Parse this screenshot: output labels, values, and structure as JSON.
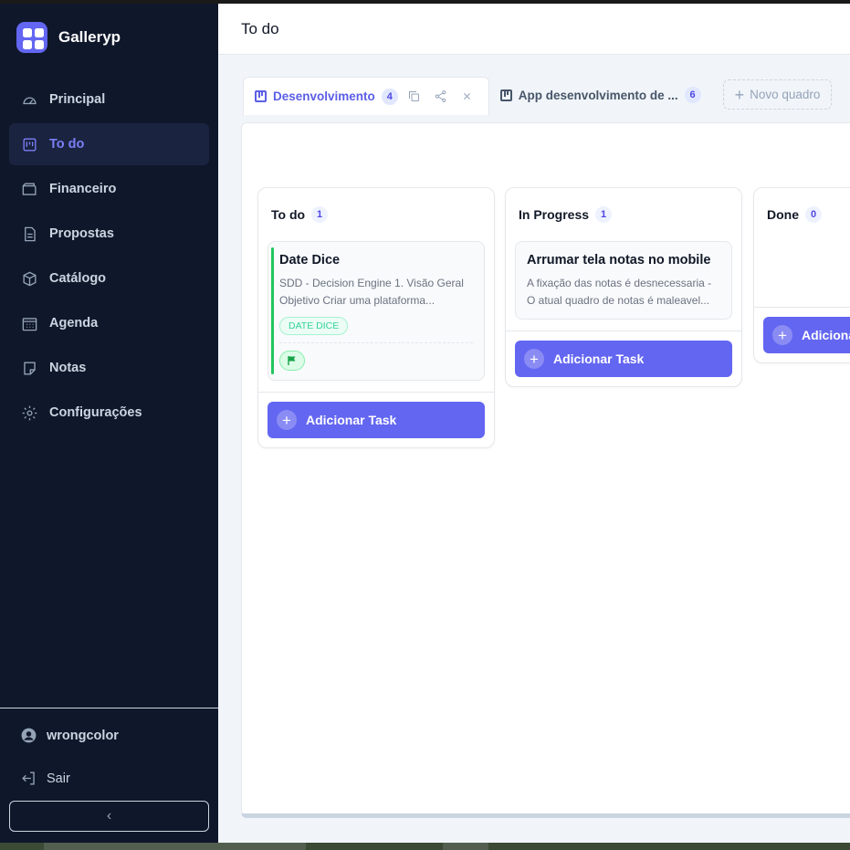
{
  "app": {
    "name": "Galleryp"
  },
  "sidebar": {
    "items": [
      {
        "label": "Principal",
        "icon": "gauge-icon",
        "active": false
      },
      {
        "label": "To do",
        "icon": "kanban-icon",
        "active": true
      },
      {
        "label": "Financeiro",
        "icon": "wallet-icon",
        "active": false
      },
      {
        "label": "Propostas",
        "icon": "document-icon",
        "active": false
      },
      {
        "label": "Catálogo",
        "icon": "box-icon",
        "active": false
      },
      {
        "label": "Agenda",
        "icon": "calendar-icon",
        "active": false
      },
      {
        "label": "Notas",
        "icon": "note-icon",
        "active": false
      },
      {
        "label": "Configurações",
        "icon": "gear-icon",
        "active": false
      }
    ],
    "user": {
      "name": "wrongcolor"
    },
    "logout_label": "Sair",
    "collapse_label": "‹"
  },
  "header": {
    "title": "To do"
  },
  "tabs": [
    {
      "label": "Desenvolvimento",
      "count": "4",
      "active": true
    },
    {
      "label": "App desenvolvimento de ...",
      "count": "6",
      "active": false
    }
  ],
  "new_board_label": "Novo quadro",
  "columns": [
    {
      "title": "To do",
      "count": "1",
      "cards": [
        {
          "title": "Date Dice",
          "description": "SDD - Decision Engine 1. Visão Geral Objetivo Criar uma plataforma...",
          "tag": "DATE DICE",
          "flag": "green"
        }
      ],
      "add_label": "Adicionar Task"
    },
    {
      "title": "In Progress",
      "count": "1",
      "cards": [
        {
          "title": "Arrumar tela notas no mobile",
          "description": "A fixação das notas é desnecessaria - O atual quadro de notas é maleavel..."
        }
      ],
      "add_label": "Adicionar Task"
    },
    {
      "title": "Done",
      "count": "0",
      "cards": [],
      "add_label": "Adicionar Task"
    }
  ],
  "colors": {
    "accent": "#6366f1",
    "sidebar_bg": "#0f172a",
    "active_text": "#7b7ff5",
    "flag_green": "#22c55e"
  }
}
